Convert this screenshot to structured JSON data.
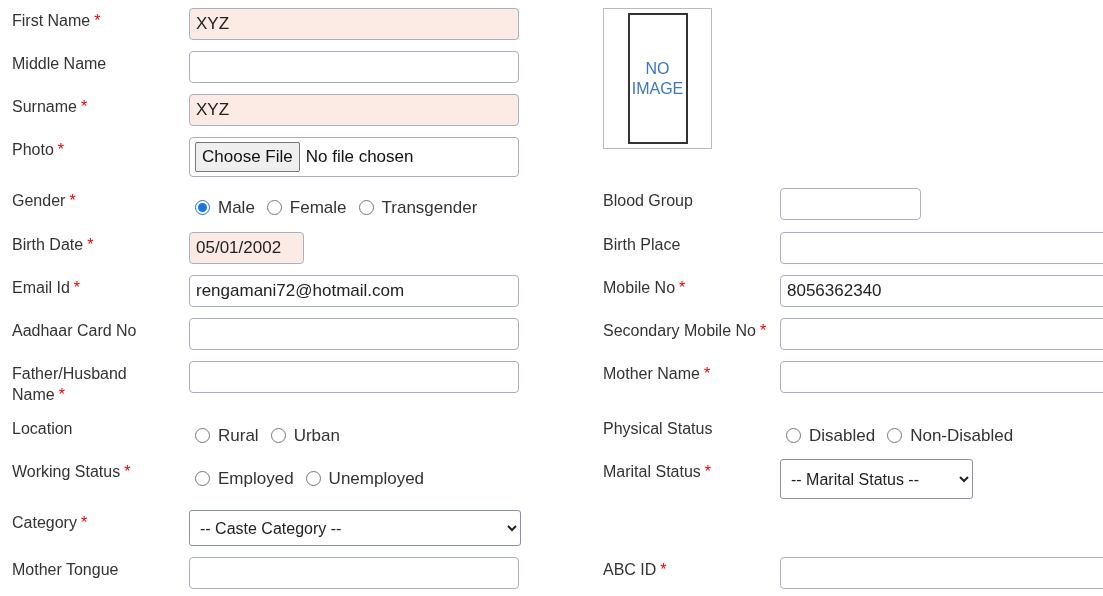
{
  "photo_preview": {
    "text": "NO IMAGE"
  },
  "rows": [
    {
      "left": {
        "label": "First Name",
        "required_mark": "*",
        "kind": "text",
        "value": "XYZ",
        "readonly": true
      },
      "right": null
    },
    {
      "left": {
        "label": "Middle Name",
        "kind": "text",
        "readonly": false
      },
      "right": null
    },
    {
      "left": {
        "label": "Surname",
        "required_mark": "*",
        "kind": "text",
        "value": "XYZ",
        "readonly": true
      },
      "right": null
    },
    {
      "left": {
        "label": "Photo",
        "required_mark": "*",
        "kind": "file",
        "button": "Choose File",
        "status": "No file chosen"
      },
      "right": null
    },
    {
      "left": {
        "label": "Gender",
        "required_mark": "*",
        "kind": "radio",
        "options": [
          {
            "label": "Male",
            "selected": true
          },
          {
            "label": "Female",
            "selected": false
          },
          {
            "label": "Transgender",
            "selected": false
          }
        ]
      },
      "right": {
        "label": "Blood Group",
        "kind": "short",
        "readonly": false
      }
    },
    {
      "left": {
        "label": "Birth Date",
        "required_mark": "*",
        "kind": "date",
        "value": "05/01/2002",
        "readonly": true
      },
      "right": {
        "label": "Birth Place",
        "kind": "text",
        "readonly": false
      }
    },
    {
      "left": {
        "label": "Email Id",
        "required_mark": "*",
        "kind": "text",
        "value": "rengamani72@hotmail.com",
        "readonly": false
      },
      "right": {
        "label": "Mobile No",
        "required_mark": "*",
        "kind": "text",
        "value": "8056362340",
        "readonly": false
      }
    },
    {
      "left": {
        "label": "Aadhaar Card No",
        "kind": "text",
        "readonly": false
      },
      "right": {
        "label": "Secondary Mobile No",
        "required_mark": "*",
        "kind": "text",
        "readonly": false
      }
    },
    {
      "left": {
        "label": "Father/Husband Name",
        "required_mark": "*",
        "kind": "text",
        "readonly": false
      },
      "right": {
        "label": "Mother Name",
        "required_mark": "*",
        "kind": "text",
        "readonly": false
      }
    },
    {
      "left": {
        "label": "Location",
        "kind": "radio",
        "options": [
          {
            "label": "Rural",
            "selected": false
          },
          {
            "label": "Urban",
            "selected": false
          }
        ]
      },
      "right": {
        "label": "Physical Status",
        "kind": "radio",
        "options": [
          {
            "label": "Disabled",
            "selected": false
          },
          {
            "label": "Non-Disabled",
            "selected": false
          }
        ]
      }
    },
    {
      "left": {
        "label": "Working Status",
        "required_mark": "*",
        "kind": "radio",
        "options": [
          {
            "label": "Employed",
            "selected": false
          },
          {
            "label": "Unemployed",
            "selected": false
          }
        ]
      },
      "right": {
        "label": "Marital Status",
        "required_mark": "*",
        "kind": "select",
        "value": "-- Marital Status --"
      }
    },
    {
      "left": {
        "label": "Category",
        "required_mark": "*",
        "kind": "select",
        "value": "-- Caste Category --"
      },
      "right": null
    },
    {
      "left": {
        "label": "Mother Tongue",
        "kind": "text",
        "readonly": false
      },
      "right": {
        "label": "ABC ID",
        "required_mark": "*",
        "kind": "text",
        "readonly": false
      }
    }
  ]
}
